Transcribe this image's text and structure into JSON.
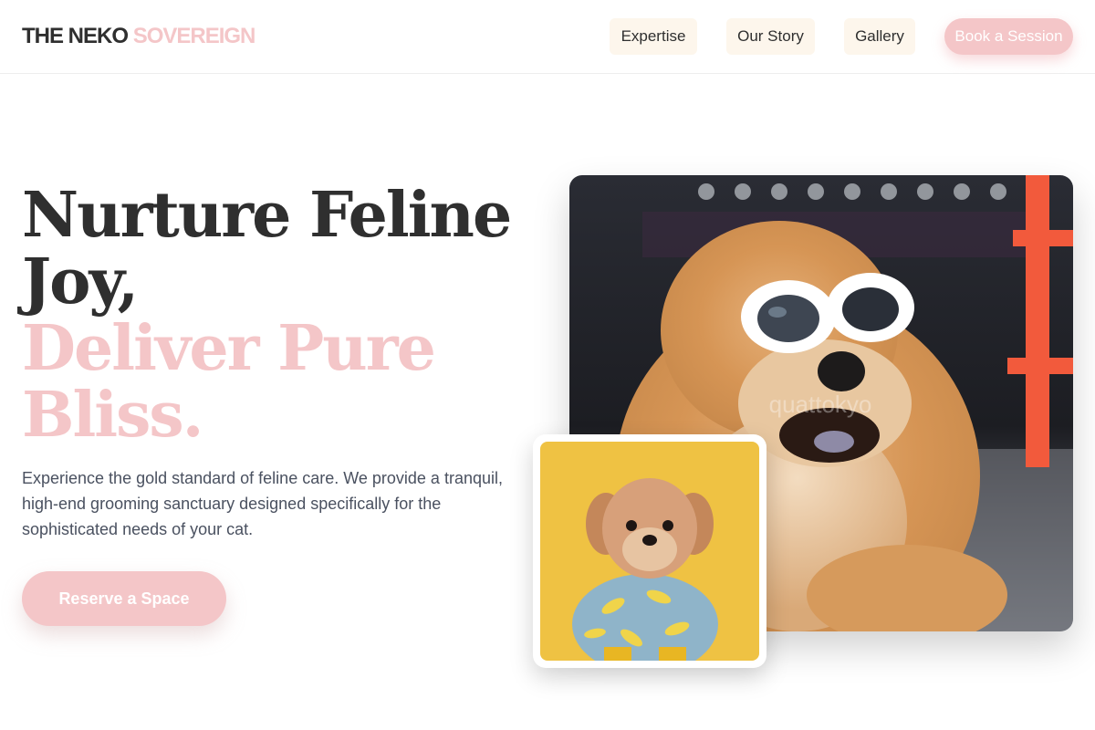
{
  "header": {
    "logo_part1": "THE NEKO",
    "logo_part2": "SOVEREIGN",
    "nav": {
      "expertise": "Expertise",
      "story": "Our Story",
      "gallery": "Gallery"
    },
    "book_label": "Book a Session"
  },
  "hero": {
    "headline_line1": "Nurture Feline",
    "headline_line2": "Joy,",
    "headline_line3": "Deliver Pure",
    "headline_line4": "Bliss.",
    "description": "Experience the gold standard of feline care. We provide a tranquil, high-end grooming sanctuary designed specifically for the sophisticated needs of your cat.",
    "cta_label": "Reserve a Space"
  },
  "images": {
    "main_photo_watermark": "quattokyo",
    "main_photo_subject": "fluffy dog wearing white sunglasses",
    "small_photo_subject": "small dog in banana-print outfit on yellow background"
  },
  "colors": {
    "accent_pink": "#f4c6c8",
    "text_dark": "#2f2f2f",
    "text_body": "#4a5160",
    "nav_bg": "#fdf6ec"
  }
}
